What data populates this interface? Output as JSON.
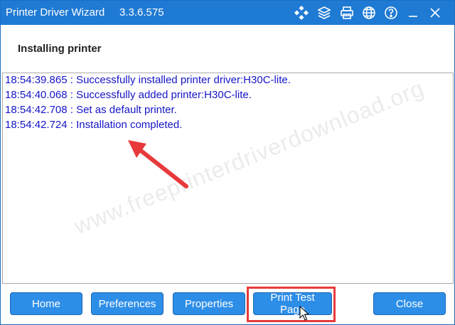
{
  "titlebar": {
    "title": "Printer Driver Wizard",
    "version": "3.3.6.575",
    "icons": [
      "diamond-grid-icon",
      "layers-icon",
      "printer-icon",
      "globe-icon",
      "help-icon",
      "minimize-icon",
      "close-icon"
    ]
  },
  "header": {
    "heading": "Installing printer"
  },
  "log": {
    "lines": [
      "18:54:39.865 : Successfully installed printer driver:H30C-lite.",
      "18:54:40.068 : Successfully added printer:H30C-lite.",
      "18:54:42.708 : Set as default printer.",
      "18:54:42.724 : Installation completed."
    ]
  },
  "watermark": "www.freeprinterdriverdownload.org",
  "buttons": {
    "home": "Home",
    "preferences": "Preferences",
    "properties": "Properties",
    "print_test_page": "Print Test Page",
    "close": "Close"
  },
  "colors": {
    "titlebar": "#1f7ad4",
    "log_text": "#1515c8",
    "button": "#2d8ee8",
    "annotation": "#e8393a"
  }
}
